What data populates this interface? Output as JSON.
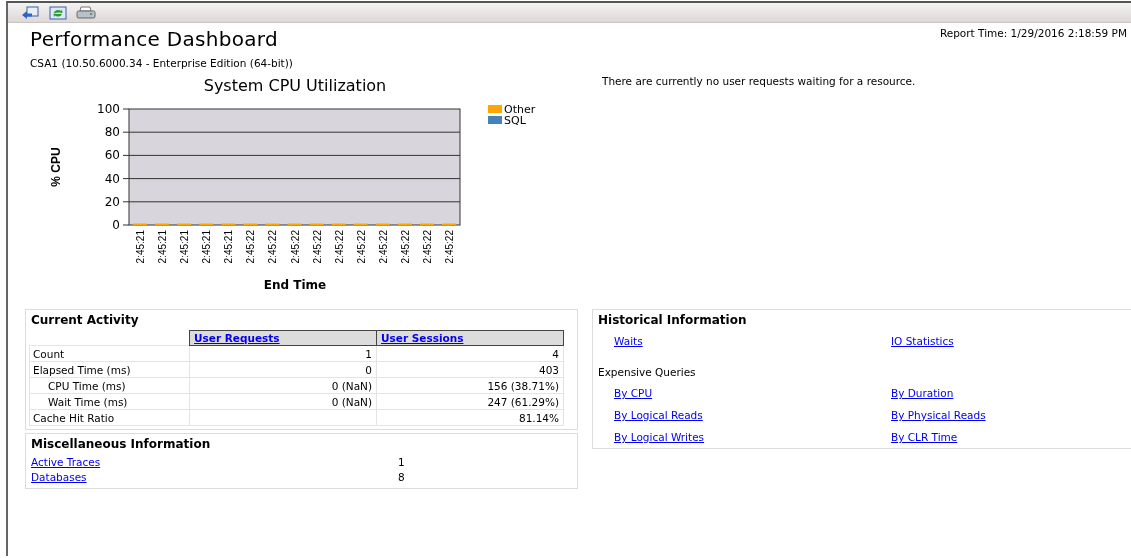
{
  "toolbar": {
    "buttons": [
      {
        "kind": "back"
      },
      {
        "kind": "refresh"
      },
      {
        "kind": "print"
      }
    ]
  },
  "report": {
    "title": "Performance Dashboard",
    "subtitle": "CSA1 (10.50.6000.34 - Enterprise Edition (64-bit))",
    "report_time": "Report Time: 1/29/2016 2:18:59 PM",
    "message": "There are currently no user requests waiting for a resource."
  },
  "cpu_chart": {
    "chart_data": {
      "type": "bar",
      "title": "System CPU Utilization",
      "xlabel": "End Time",
      "ylabel": "% CPU",
      "stacked": true,
      "categories": [
        "2:45:21",
        "2:45:21",
        "2:45:21",
        "2:45:21",
        "2:45:21",
        "2:45:22",
        "2:45:22",
        "2:45:22",
        "2:45:22",
        "2:45:22",
        "2:45:22",
        "2:45:22",
        "2:45:22",
        "2:45:22",
        "2:45:22"
      ],
      "series": [
        {
          "name": "Other",
          "color": "#ffa500",
          "values": [
            0,
            0,
            0,
            0,
            0,
            0,
            0,
            0,
            0,
            0,
            0,
            0,
            0,
            0,
            0
          ]
        },
        {
          "name": "SQL",
          "color": "#4682b4",
          "values": [
            0,
            0,
            0,
            0,
            0,
            0,
            0,
            0,
            0,
            0,
            0,
            0,
            0,
            0,
            0
          ]
        }
      ],
      "grid": true,
      "ylim": [
        0,
        100
      ],
      "yticks": [
        0,
        20,
        40,
        60,
        80,
        100
      ]
    }
  },
  "current_activity": {
    "title": "Current Activity",
    "columns": [
      "User Requests",
      "User Sessions"
    ],
    "rows": [
      {
        "label": "Count",
        "user_requests": "1",
        "user_sessions": "4"
      },
      {
        "label": "Elapsed Time (ms)",
        "user_requests": "0",
        "user_sessions": "403",
        "children": [
          {
            "label": "CPU Time (ms)",
            "user_requests": "0 (NaN)",
            "user_sessions": "156 (38.71%)"
          },
          {
            "label": "Wait Time (ms)",
            "user_requests": "0 (NaN)",
            "user_sessions": "247 (61.29%)"
          }
        ]
      },
      {
        "label": "Cache Hit Ratio",
        "user_sessions": "81.14%"
      }
    ]
  },
  "miscellaneous": {
    "title": "Miscellaneous Information",
    "items": [
      {
        "label": "Active Traces",
        "value": "1"
      },
      {
        "label": "Databases",
        "value": "8"
      }
    ]
  },
  "historical": {
    "title": "Historical Information",
    "links": [
      "Waits",
      "IO Statistics"
    ],
    "section": "Expensive Queries",
    "query_links": [
      "By CPU",
      "By Duration",
      "By Logical Reads",
      "By Physical Reads",
      "By Logical Writes",
      "By CLR Time"
    ]
  }
}
